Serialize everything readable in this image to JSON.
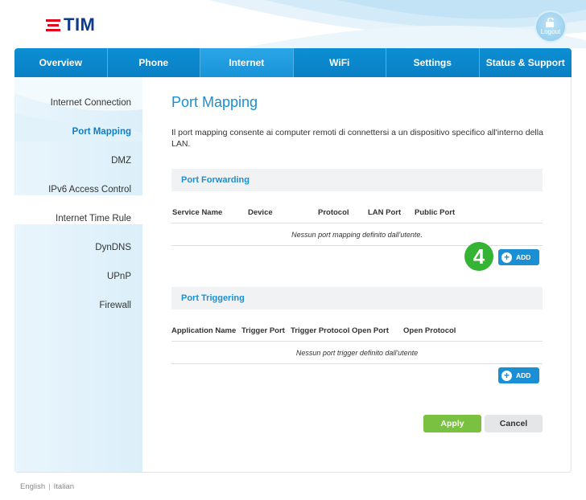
{
  "header": {
    "logo_text": "TIM",
    "logout_label": "Logout"
  },
  "nav": {
    "tabs": [
      {
        "label": "Overview"
      },
      {
        "label": "Phone"
      },
      {
        "label": "Internet"
      },
      {
        "label": "WiFi"
      },
      {
        "label": "Settings"
      },
      {
        "label": "Status & Support"
      }
    ],
    "active": "Internet"
  },
  "sidebar": {
    "items": [
      {
        "label": "Internet Connection"
      },
      {
        "label": "Port Mapping"
      },
      {
        "label": "DMZ"
      },
      {
        "label": "IPv6 Access Control"
      },
      {
        "label": "Internet Time Rule"
      },
      {
        "label": "DynDNS"
      },
      {
        "label": "UPnP"
      },
      {
        "label": "Firewall"
      }
    ],
    "active": "Port Mapping"
  },
  "main": {
    "title": "Port Mapping",
    "description": "Il port mapping consente ai computer remoti di connettersi a un dispositivo specifico all'interno della LAN.",
    "port_forwarding": {
      "title": "Port Forwarding",
      "columns": [
        "Service Name",
        "Device",
        "Protocol",
        "LAN Port",
        "Public Port"
      ],
      "empty_message": "Nessun port mapping definito dall'utente.",
      "add_label": "ADD"
    },
    "step_badge": "4",
    "port_triggering": {
      "title": "Port Triggering",
      "columns": [
        "Application Name",
        "Trigger Port",
        "Trigger Protocol",
        "Open Port",
        "Open Protocol"
      ],
      "empty_message": "Nessun port trigger definito dall'utente",
      "add_label": "ADD"
    },
    "apply_label": "Apply",
    "cancel_label": "Cancel"
  },
  "footer": {
    "languages": [
      "English",
      "Italian"
    ],
    "separator": "|"
  },
  "colors": {
    "brand_blue": "#0a7fc4",
    "accent_blue": "#1a8fd3",
    "apply_green": "#7ac142",
    "badge_green": "#35b335",
    "logo_red": "#e2001a"
  }
}
